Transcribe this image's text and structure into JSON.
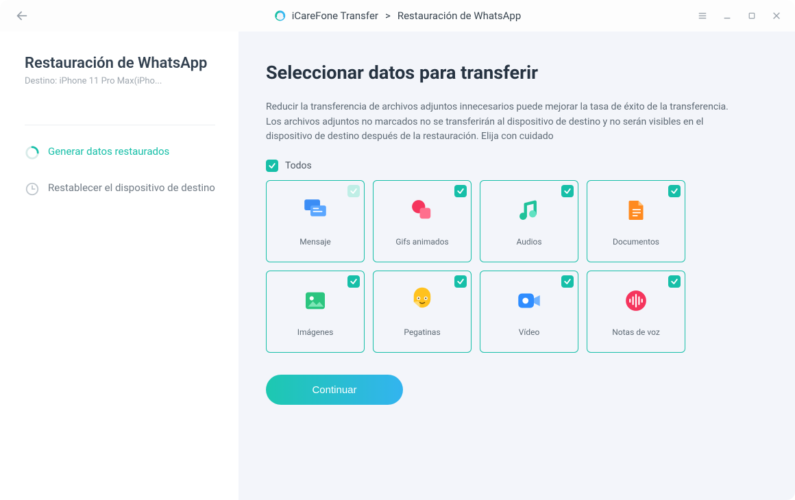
{
  "titlebar": {
    "app_name": "iCareFone Transfer",
    "breadcrumb": "Restauración de WhatsApp"
  },
  "sidebar": {
    "title": "Restauración de WhatsApp",
    "subtitle": "Destino: iPhone 11 Pro Max(iPho...",
    "steps": [
      {
        "label": "Generar datos restaurados",
        "active": true
      },
      {
        "label": "Restablecer el dispositivo de destino",
        "active": false
      }
    ]
  },
  "main": {
    "title": "Seleccionar datos para transferir",
    "description": "Reducir la transferencia de archivos adjuntos innecesarios puede mejorar la tasa de éxito de la transferencia. Los archivos adjuntos no marcados no se transferirán al dispositivo de destino y no serán visibles en el dispositivo de destino después de la restauración. Elija con cuidado",
    "all_label": "Todos",
    "items": [
      {
        "label": "Mensaje"
      },
      {
        "label": "Gifs animados"
      },
      {
        "label": "Audios"
      },
      {
        "label": "Documentos"
      },
      {
        "label": "Imágenes"
      },
      {
        "label": "Pegatinas"
      },
      {
        "label": "Vídeo"
      },
      {
        "label": "Notas de voz"
      }
    ],
    "continue_label": "Continuar"
  }
}
